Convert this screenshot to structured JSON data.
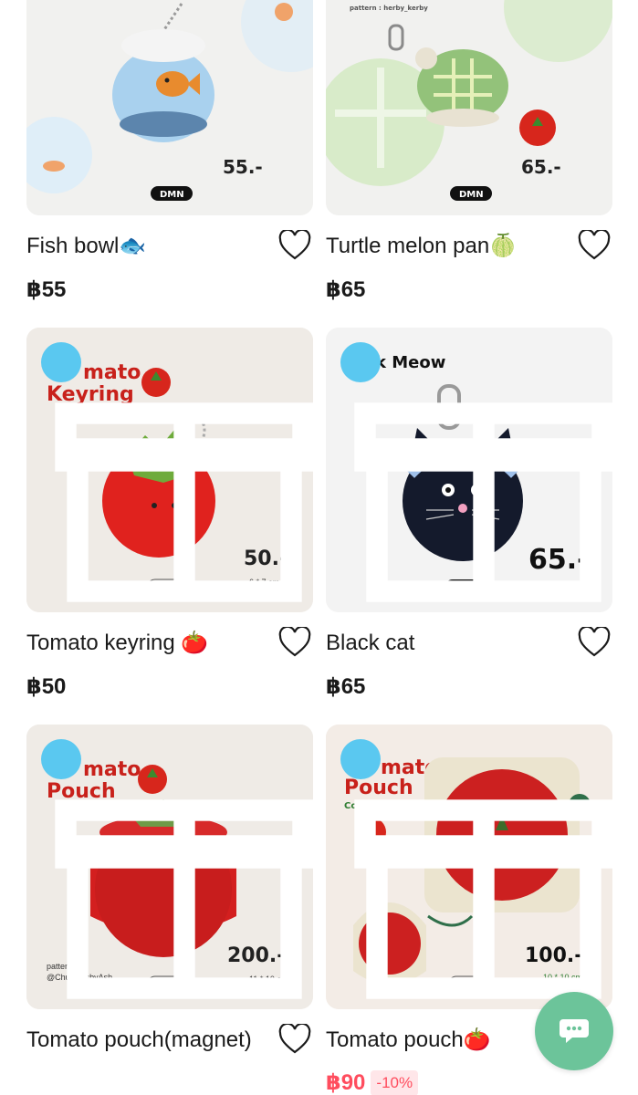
{
  "products": [
    {
      "title": "Fish bowl🐟",
      "price": "฿55",
      "image": {
        "price_tag": "55.-",
        "brand": "DMN"
      }
    },
    {
      "title": "Turtle melon pan🍈",
      "price": "฿65",
      "image": {
        "price_tag": "65.-",
        "brand": "DMN",
        "caption": "pattern : herby_kerby"
      }
    },
    {
      "title": "Tomato keyring 🍅",
      "price": "฿50",
      "image": {
        "heading1": "mato",
        "heading2": "Keyring",
        "price_tag": "50.-",
        "size": "6 * 7 cm",
        "brand": "DMN"
      }
    },
    {
      "title": "Black cat",
      "price": "฿65",
      "image": {
        "heading1": "k Meow",
        "price_tag": "65.-",
        "size": "5.5*5.5 cm",
        "brand": "DMN"
      }
    },
    {
      "title": "Tomato pouch(magnet)",
      "price": "",
      "image": {
        "heading1": "mato",
        "heading2": "Pouch",
        "price_tag": "200.-",
        "size": "11 * 10 cm",
        "brand": "DMN",
        "credit1": "pattern by",
        "credit2": "@ChubbiesbyAsh"
      }
    },
    {
      "title": "Tomato pouch🍅",
      "price": "฿90",
      "discount": "-10%",
      "image": {
        "heading1": "mato",
        "heading2": "Pouch",
        "subheading": "Cotton soft",
        "price_tag": "100.-",
        "size": "10 * 10 cm",
        "brand": "DMN"
      }
    }
  ],
  "colors": {
    "accent_sale": "#ff4d5e",
    "gift_badge": "#5ac8f0",
    "chat_fab": "#6cc49a"
  },
  "icons": {
    "wishlist": "heart-outline-icon",
    "gift": "gift-icon",
    "chat": "chat-bubble-icon"
  }
}
